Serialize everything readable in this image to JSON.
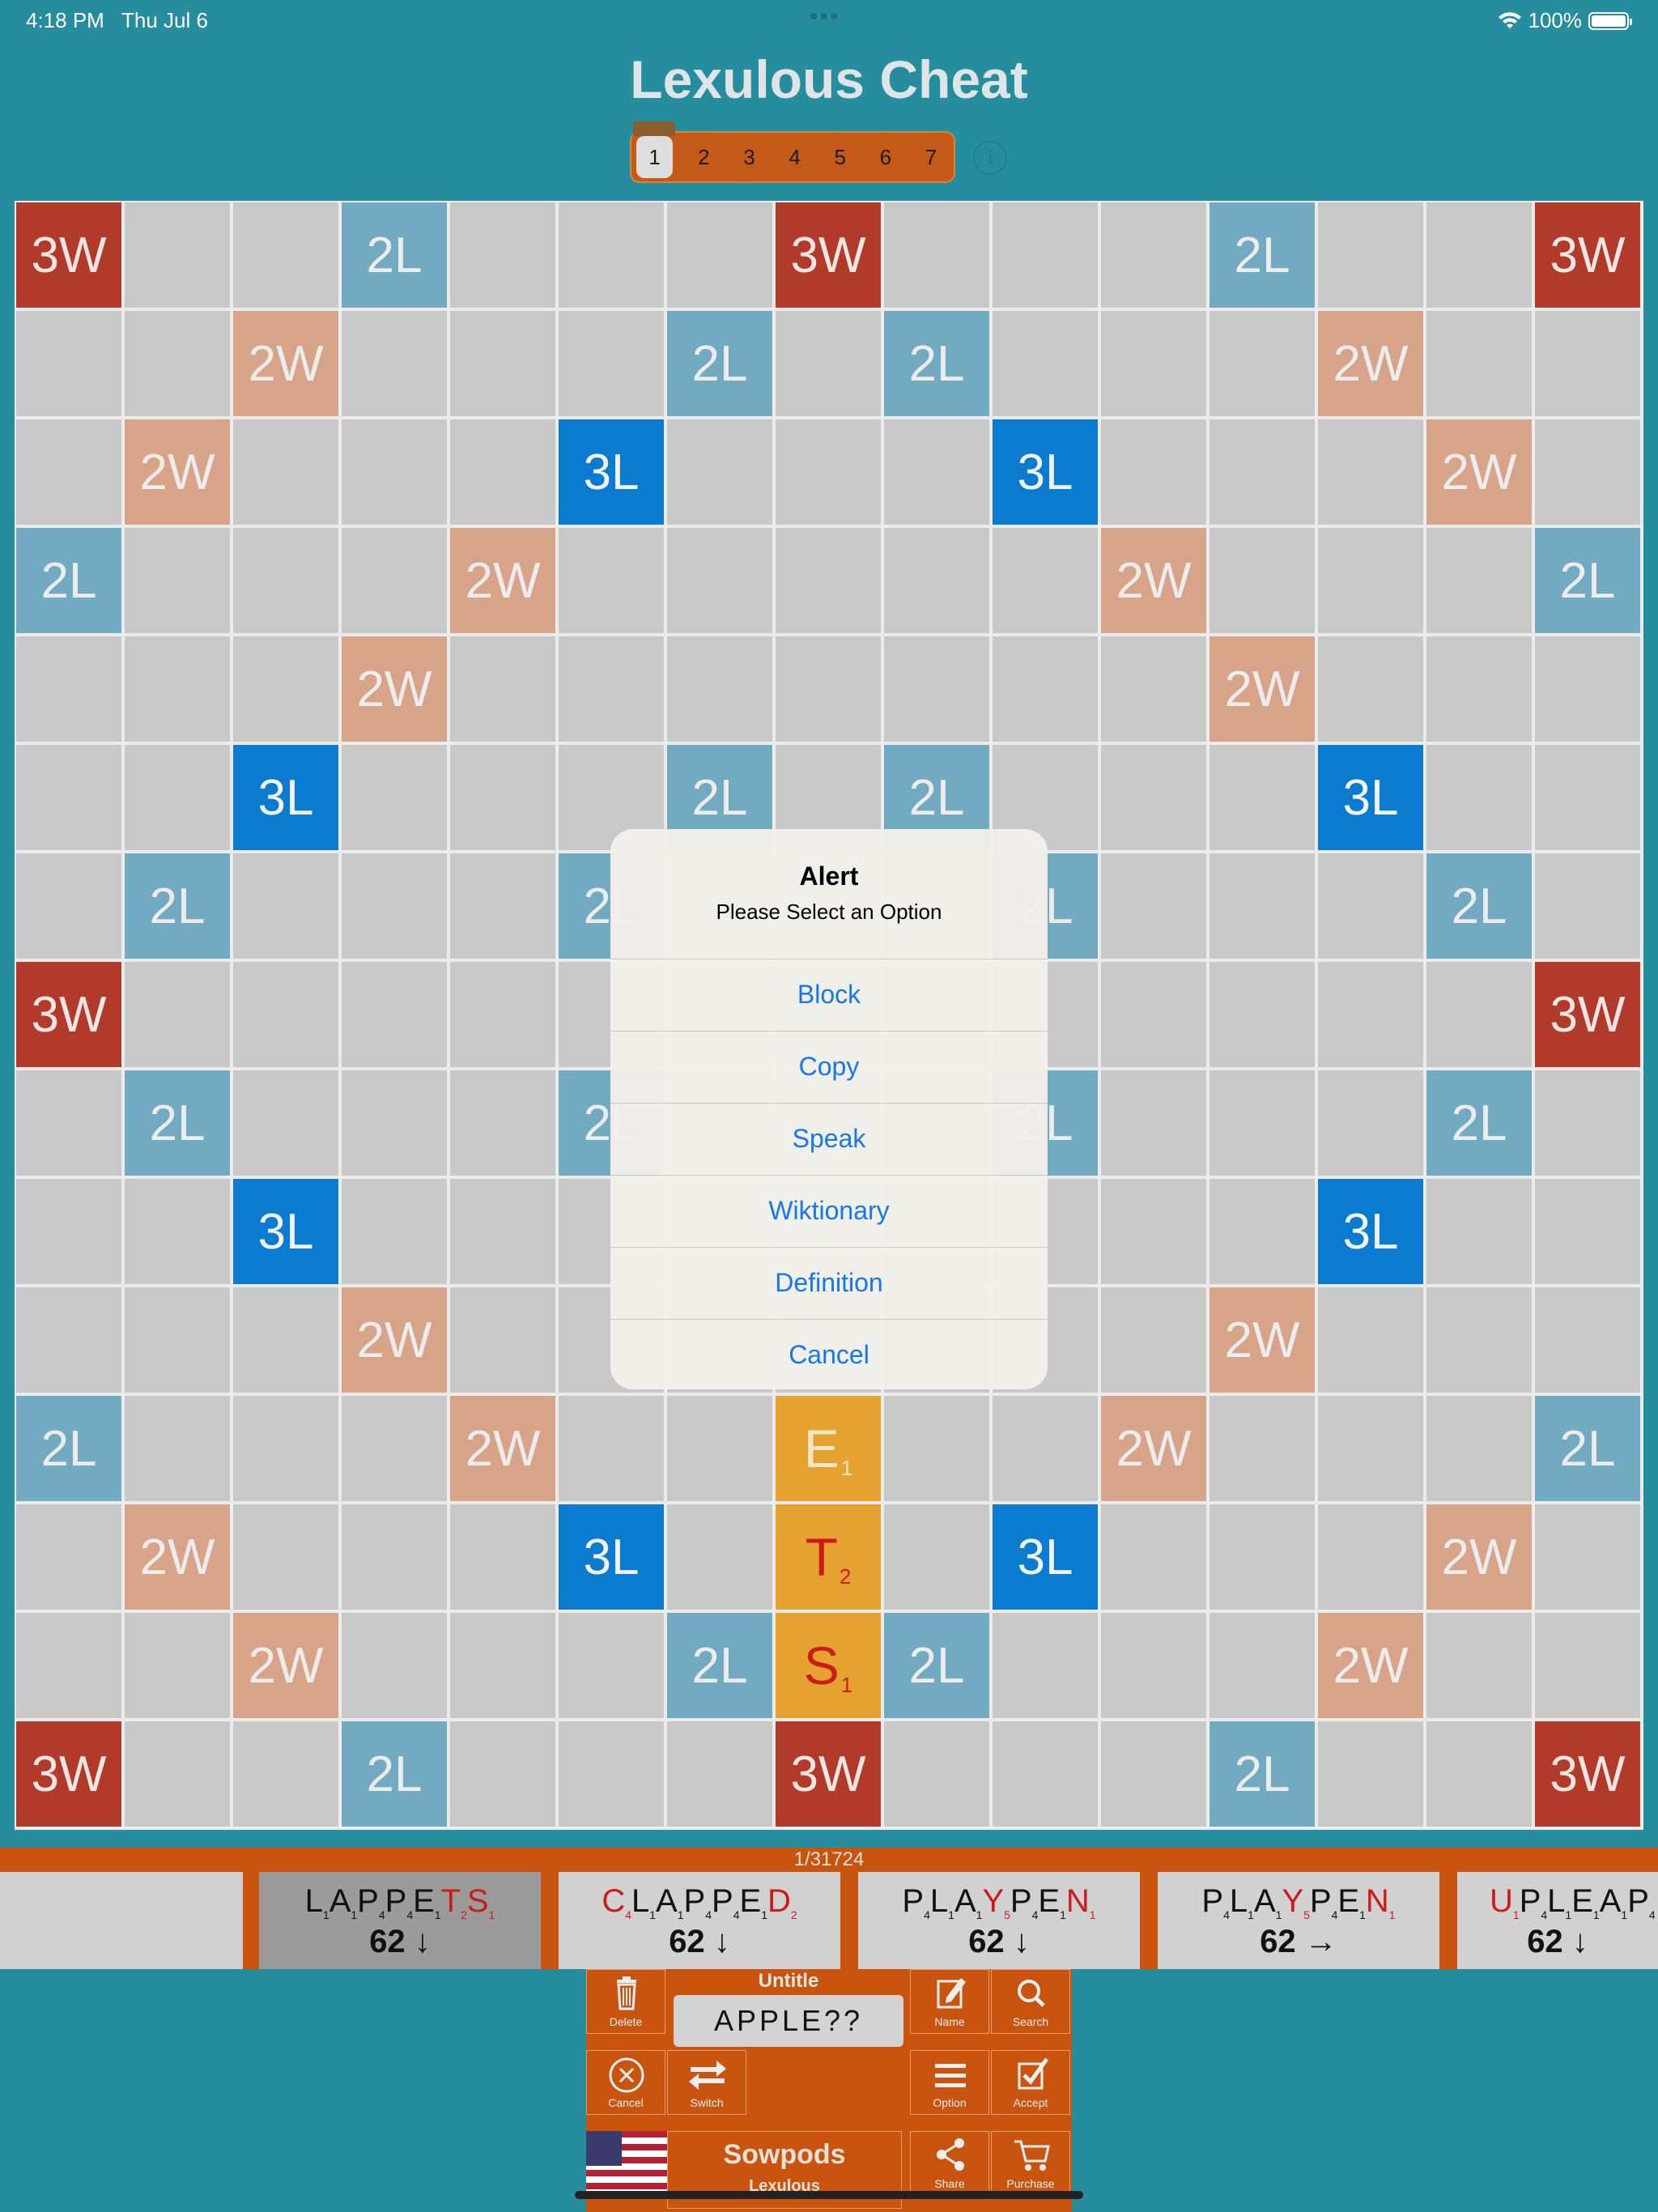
{
  "status": {
    "time": "4:18 PM",
    "date": "Thu Jul 6",
    "dots": "•••",
    "battery": "100%"
  },
  "title": "Lexulous Cheat",
  "board_tabs": [
    "1",
    "2",
    "3",
    "4",
    "5",
    "6",
    "7"
  ],
  "active_tab": "1",
  "info_icon": "i",
  "board": {
    "rows": [
      [
        "3W",
        "",
        "",
        "2L",
        "",
        "",
        "",
        "3W",
        "",
        "",
        "",
        "2L",
        "",
        "",
        "3W"
      ],
      [
        "",
        "",
        "2W",
        "",
        "",
        "",
        "2L",
        "",
        "2L",
        "",
        "",
        "",
        "2W",
        "",
        ""
      ],
      [
        "",
        "2W",
        "",
        "",
        "",
        "3L",
        "",
        "",
        "",
        "3L",
        "",
        "",
        "",
        "2W",
        ""
      ],
      [
        "2L",
        "",
        "",
        "",
        "2W",
        "",
        "",
        "",
        "",
        "",
        "2W",
        "",
        "",
        "",
        "2L"
      ],
      [
        "",
        "",
        "",
        "2W",
        "",
        "",
        "",
        "",
        "",
        "",
        "",
        "2W",
        "",
        "",
        ""
      ],
      [
        "",
        "",
        "3L",
        "",
        "",
        "",
        "2L",
        "",
        "2L",
        "",
        "",
        "",
        "3L",
        "",
        ""
      ],
      [
        "",
        "2L",
        "",
        "",
        "",
        "2L",
        "",
        "",
        "",
        "2L",
        "",
        "",
        "",
        "2L",
        ""
      ],
      [
        "3W",
        "",
        "",
        "",
        "",
        "",
        "",
        "",
        "",
        "",
        "",
        "",
        "",
        "",
        "3W"
      ],
      [
        "",
        "2L",
        "",
        "",
        "",
        "2L",
        "",
        "",
        "",
        "2L",
        "",
        "",
        "",
        "2L",
        ""
      ],
      [
        "",
        "",
        "3L",
        "",
        "",
        "",
        "",
        "",
        "",
        "",
        "",
        "",
        "3L",
        "",
        ""
      ],
      [
        "",
        "",
        "",
        "2W",
        "",
        "",
        "",
        "",
        "",
        "",
        "",
        "2W",
        "",
        "",
        ""
      ],
      [
        "2L",
        "",
        "",
        "",
        "2W",
        "",
        "",
        "E|1",
        "",
        "",
        "2W",
        "",
        "",
        "",
        "2L"
      ],
      [
        "",
        "2W",
        "",
        "",
        "",
        "3L",
        "",
        "T|2|r",
        "",
        "3L",
        "",
        "",
        "",
        "2W",
        ""
      ],
      [
        "",
        "",
        "2W",
        "",
        "",
        "",
        "2L",
        "S|1|r",
        "2L",
        "",
        "",
        "",
        "2W",
        "",
        ""
      ],
      [
        "3W",
        "",
        "",
        "2L",
        "",
        "",
        "",
        "3W",
        "",
        "",
        "",
        "2L",
        "",
        "",
        "3W"
      ]
    ]
  },
  "alert": {
    "title": "Alert",
    "message": "Please Select an Option",
    "buttons": [
      "Block",
      "Copy",
      "Speak",
      "Wiktionary",
      "Definition",
      "Cancel"
    ]
  },
  "results": {
    "count": "1/31724",
    "cards": [
      {
        "letters": [
          [
            "L",
            "1"
          ],
          [
            "A",
            "1"
          ],
          [
            "P",
            "4"
          ],
          [
            "P",
            "4"
          ],
          [
            "E",
            "1"
          ],
          [
            "T",
            "2",
            "r"
          ],
          [
            "S",
            "1",
            "r"
          ]
        ],
        "score": "62 ↓",
        "selected": true
      },
      {
        "letters": [
          [
            "C",
            "4",
            "r"
          ],
          [
            "L",
            "1"
          ],
          [
            "A",
            "1"
          ],
          [
            "P",
            "4"
          ],
          [
            "P",
            "4"
          ],
          [
            "E",
            "1"
          ],
          [
            "D",
            "2",
            "r"
          ]
        ],
        "score": "62 ↓",
        "selected": false
      },
      {
        "letters": [
          [
            "P",
            "4"
          ],
          [
            "L",
            "1"
          ],
          [
            "A",
            "1"
          ],
          [
            "Y",
            "5",
            "r"
          ],
          [
            "P",
            "4"
          ],
          [
            "E",
            "1"
          ],
          [
            "N",
            "1",
            "r"
          ]
        ],
        "score": "62 ↓",
        "selected": false
      },
      {
        "letters": [
          [
            "P",
            "4"
          ],
          [
            "L",
            "1"
          ],
          [
            "A",
            "1"
          ],
          [
            "Y",
            "5",
            "r"
          ],
          [
            "P",
            "4"
          ],
          [
            "E",
            "1"
          ],
          [
            "N",
            "1",
            "r"
          ]
        ],
        "score": "62 →",
        "selected": false
      },
      {
        "letters": [
          [
            "U",
            "1",
            "r"
          ],
          [
            "P",
            "4"
          ],
          [
            "L",
            "1"
          ],
          [
            "E",
            "1"
          ],
          [
            "A",
            "1"
          ],
          [
            "P",
            "4"
          ]
        ],
        "score": "62 ↓",
        "selected": false
      }
    ]
  },
  "controls": {
    "untitle": "Untitle",
    "input": "APPLE??",
    "delete": "Delete",
    "name": "Name",
    "search": "Search",
    "cancel": "Cancel",
    "switch": "Switch",
    "option": "Option",
    "accept": "Accept",
    "dict_name": "Sowpods",
    "dict_sub": "Lexulous",
    "share": "Share",
    "purchase": "Purchase"
  },
  "icons": [
    "wifi-icon",
    "battery-icon",
    "info-icon",
    "trash-icon",
    "edit-icon",
    "magnifier-icon",
    "close-circle-icon",
    "swap-icon",
    "menu-icon",
    "checkbox-icon",
    "share-icon",
    "cart-icon",
    "us-flag-icon"
  ],
  "colors": {
    "background": "#268d9f",
    "accent": "#c85410",
    "triple_word": "#b23a2a",
    "double_word": "#d7a48a",
    "double_letter": "#72aac2",
    "triple_letter": "#0b7bd0",
    "tile": "#e5a230",
    "alert_button": "#1577ea"
  }
}
